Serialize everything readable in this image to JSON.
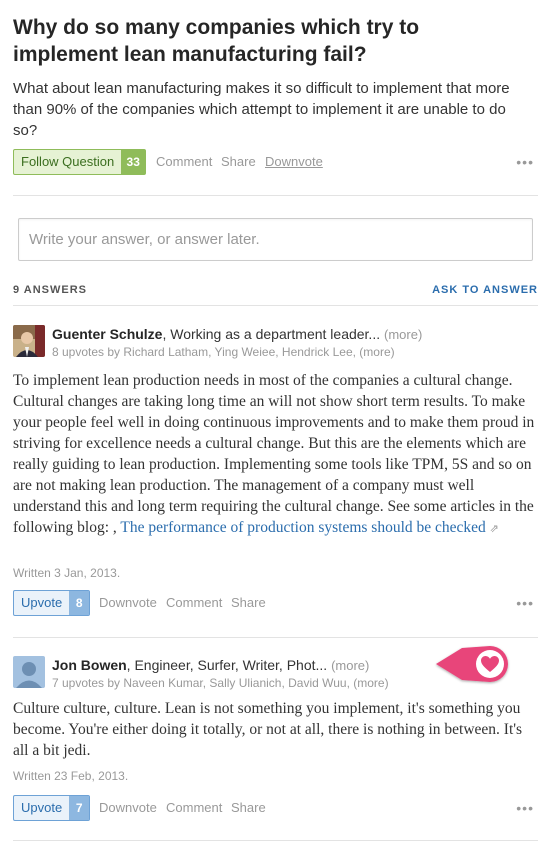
{
  "question": {
    "title": "Why do so many companies which try to implement lean manufacturing fail?",
    "detail": "What about lean manufacturing makes it so difficult to implement that more than 90% of the companies which attempt to implement it are unable to do so?",
    "follow_label": "Follow Question",
    "follow_count": "33",
    "comment_label": "Comment",
    "share_label": "Share",
    "downvote_label": "Downvote",
    "more_label": "•••"
  },
  "answer_box": {
    "placeholder": "Write your answer, or answer later."
  },
  "answers_header": {
    "count_label": "9 ANSWERS",
    "ask_label": "ASK TO ANSWER"
  },
  "answers": [
    {
      "author": "Guenter Schulze",
      "credential": ", Working as a department leader...",
      "more": "(more)",
      "upvoters": "8 upvotes by Richard Latham, Ying Weiee, Hendrick Lee, (more)",
      "body": "To implement lean production needs in most of the companies a cultural change. Cultural changes are taking long time an will not show short term results. To make your people feel well in doing continuous improvements and to make them proud in striving for excellence needs a cultural change. But this are the elements which are really guiding to lean production. Implementing some tools like TPM, 5S and so on are not making lean production. The management of a company must well understand this and long term requiring the cultural change. See some articles in the following blog: , ",
      "link_text": "The performance of production systems should be checked",
      "link_icon": "⇗",
      "written": "Written 3 Jan, 2013.",
      "upvote_label": "Upvote",
      "upvote_count": "8",
      "downvote_label": "Downvote",
      "comment_label": "Comment",
      "share_label": "Share",
      "more_label": "•••",
      "avatar_icon": "person-photo-icon"
    },
    {
      "author": "Jon Bowen",
      "credential": ", Engineer, Surfer, Writer, Phot...",
      "more": "(more)",
      "upvoters": "7 upvotes by Naveen Kumar, Sally Ulianich, David Wuu, (more)",
      "body": "Culture culture, culture.   Lean is not something you implement, it's something you become.  You're either doing it totally, or not at all, there is nothing in between.  It's all a bit jedi.",
      "written": "Written 23 Feb, 2013.",
      "upvote_label": "Upvote",
      "upvote_count": "7",
      "downvote_label": "Downvote",
      "comment_label": "Comment",
      "share_label": "Share",
      "more_label": "•••",
      "avatar_icon": "default-avatar-icon"
    }
  ],
  "overlay": {
    "icon": "heart-icon",
    "color": "#e8457a"
  }
}
